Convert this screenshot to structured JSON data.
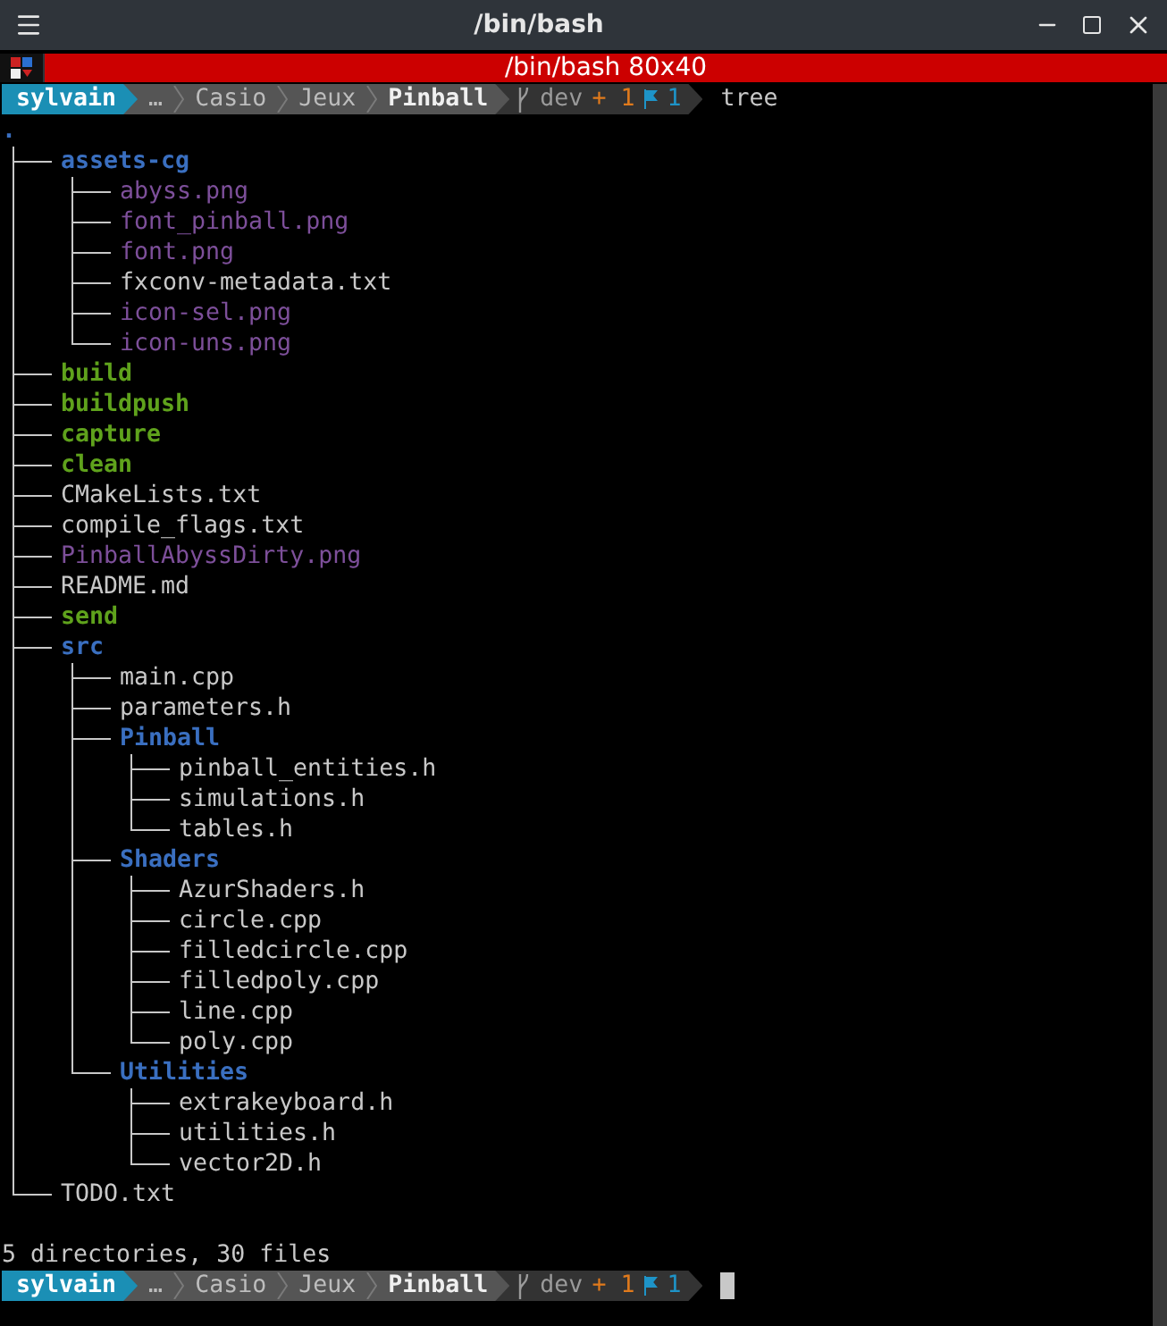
{
  "window": {
    "title": "/bin/bash"
  },
  "tab": {
    "title": "/bin/bash 80x40"
  },
  "prompt_top": {
    "user": "sylvain",
    "path": [
      "…",
      "Casio",
      "Jeux",
      "Pinball"
    ],
    "branch": "dev",
    "staged": "+ 1",
    "flags": "1",
    "command": "tree"
  },
  "tree": {
    "root": ".",
    "entries": [
      {
        "name": "assets-cg",
        "kind": "dir",
        "children": [
          {
            "name": "abyss.png",
            "kind": "image"
          },
          {
            "name": "font_pinball.png",
            "kind": "image"
          },
          {
            "name": "font.png",
            "kind": "image"
          },
          {
            "name": "fxconv-metadata.txt",
            "kind": "file"
          },
          {
            "name": "icon-sel.png",
            "kind": "image"
          },
          {
            "name": "icon-uns.png",
            "kind": "image"
          }
        ]
      },
      {
        "name": "build",
        "kind": "exec"
      },
      {
        "name": "buildpush",
        "kind": "exec"
      },
      {
        "name": "capture",
        "kind": "exec"
      },
      {
        "name": "clean",
        "kind": "exec"
      },
      {
        "name": "CMakeLists.txt",
        "kind": "file"
      },
      {
        "name": "compile_flags.txt",
        "kind": "file"
      },
      {
        "name": "PinballAbyssDirty.png",
        "kind": "image"
      },
      {
        "name": "README.md",
        "kind": "file"
      },
      {
        "name": "send",
        "kind": "exec"
      },
      {
        "name": "src",
        "kind": "dir",
        "children": [
          {
            "name": "main.cpp",
            "kind": "file"
          },
          {
            "name": "parameters.h",
            "kind": "file"
          },
          {
            "name": "Pinball",
            "kind": "dir",
            "children": [
              {
                "name": "pinball_entities.h",
                "kind": "file"
              },
              {
                "name": "simulations.h",
                "kind": "file"
              },
              {
                "name": "tables.h",
                "kind": "file"
              }
            ]
          },
          {
            "name": "Shaders",
            "kind": "dir",
            "children": [
              {
                "name": "AzurShaders.h",
                "kind": "file"
              },
              {
                "name": "circle.cpp",
                "kind": "file"
              },
              {
                "name": "filledcircle.cpp",
                "kind": "file"
              },
              {
                "name": "filledpoly.cpp",
                "kind": "file"
              },
              {
                "name": "line.cpp",
                "kind": "file"
              },
              {
                "name": "poly.cpp",
                "kind": "file"
              }
            ]
          },
          {
            "name": "Utilities",
            "kind": "dir",
            "children": [
              {
                "name": "extrakeyboard.h",
                "kind": "file"
              },
              {
                "name": "utilities.h",
                "kind": "file"
              },
              {
                "name": "vector2D.h",
                "kind": "file"
              }
            ]
          }
        ]
      },
      {
        "name": "TODO.txt",
        "kind": "file"
      }
    ]
  },
  "summary": "5 directories, 30 files",
  "prompt_bottom": {
    "user": "sylvain",
    "path": [
      "…",
      "Casio",
      "Jeux",
      "Pinball"
    ],
    "branch": "dev",
    "staged": "+ 1",
    "flags": "1",
    "cursor": true
  }
}
